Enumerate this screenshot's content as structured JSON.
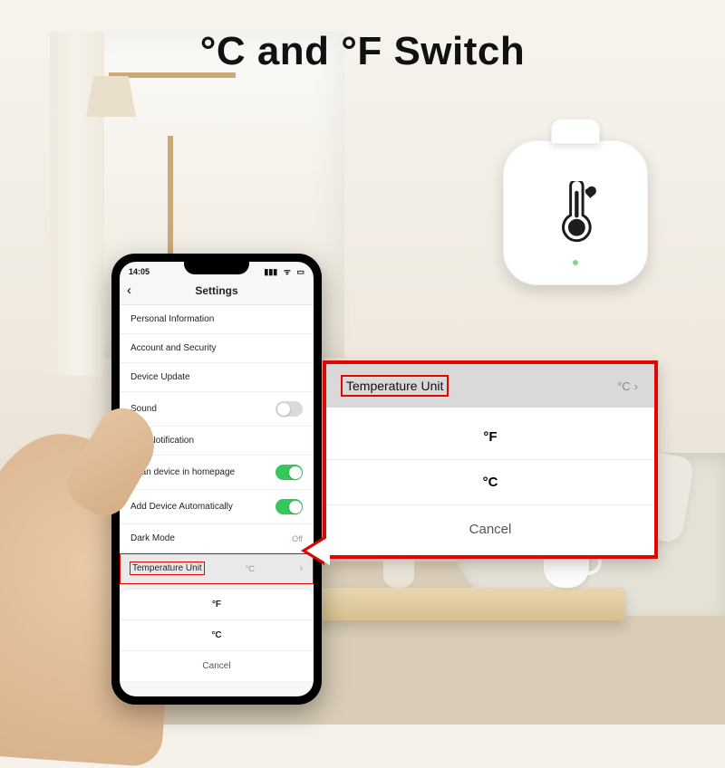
{
  "headline": "°C and °F Switch",
  "status": {
    "time": "14:05",
    "wifi_icon": "wifi",
    "signal_icon": "signal",
    "battery_icon": "battery"
  },
  "navbar": {
    "title": "Settings"
  },
  "settings": {
    "rows": [
      {
        "label": "Personal Information",
        "type": "link"
      },
      {
        "label": "Account and Security",
        "type": "link"
      },
      {
        "label": "Device Update",
        "type": "link"
      },
      {
        "label": "Sound",
        "type": "toggle",
        "on": false
      },
      {
        "label": "App Notification",
        "type": "link"
      },
      {
        "label": "Scan device in homepage",
        "type": "toggle",
        "on": true
      },
      {
        "label": "Add Device Automatically",
        "type": "toggle",
        "on": true
      },
      {
        "label": "Dark Mode",
        "type": "value",
        "value": "Off"
      },
      {
        "label": "Temperature Unit",
        "type": "value",
        "value": "°C",
        "highlighted": true
      }
    ]
  },
  "sheet": {
    "options": [
      "°F",
      "°C"
    ],
    "cancel": "Cancel"
  },
  "callout": {
    "header_label": "Temperature Unit",
    "header_value": "°C",
    "options": [
      "°F",
      "°C"
    ],
    "cancel": "Cancel"
  }
}
